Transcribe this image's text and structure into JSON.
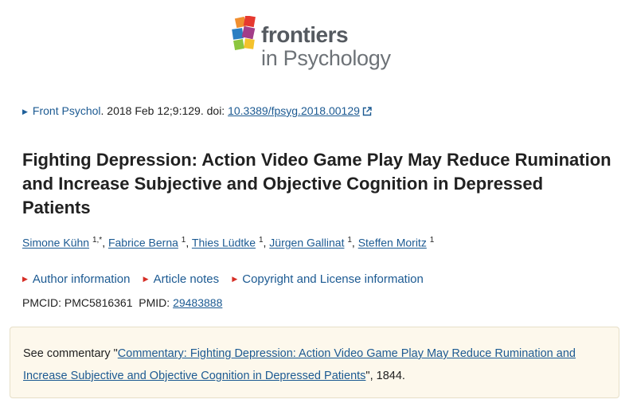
{
  "journal": {
    "logo_line1": "frontiers",
    "logo_line2": "in Psychology"
  },
  "citation": {
    "journal_link": "Front Psychol",
    "details": ". 2018 Feb 12;9:129. doi: ",
    "doi": "10.3389/fpsyg.2018.00129"
  },
  "article": {
    "title": "Fighting Depression: Action Video Game Play May Reduce Rumination and Increase Subjective and Objective Cognition in Depressed Patients"
  },
  "authors": [
    {
      "name": "Simone Kühn",
      "sup": "1,*",
      "sep": ", "
    },
    {
      "name": "Fabrice Berna",
      "sup": "1",
      "sep": ", "
    },
    {
      "name": "Thies Lüdtke",
      "sup": "1",
      "sep": ", "
    },
    {
      "name": "Jürgen Gallinat",
      "sup": "1",
      "sep": ", "
    },
    {
      "name": "Steffen Moritz",
      "sup": "1",
      "sep": ""
    }
  ],
  "info_links": [
    "Author information",
    "Article notes",
    "Copyright and License information"
  ],
  "ids": {
    "pmcid_label": "PMCID: ",
    "pmcid": "PMC5816361",
    "pmid_label": "PMID: ",
    "pmid": "29483888"
  },
  "commentary": {
    "prefix": "See commentary \"",
    "link": "Commentary: Fighting Depression: Action Video Game Play May Reduce Rumination and Increase Subjective and Objective Cognition in Depressed Patients",
    "suffix": "\", 1844."
  },
  "colors": {
    "link": "#1c5a92",
    "commentary_bg": "#fdf8ec",
    "bullet_red": "#d62e26"
  }
}
